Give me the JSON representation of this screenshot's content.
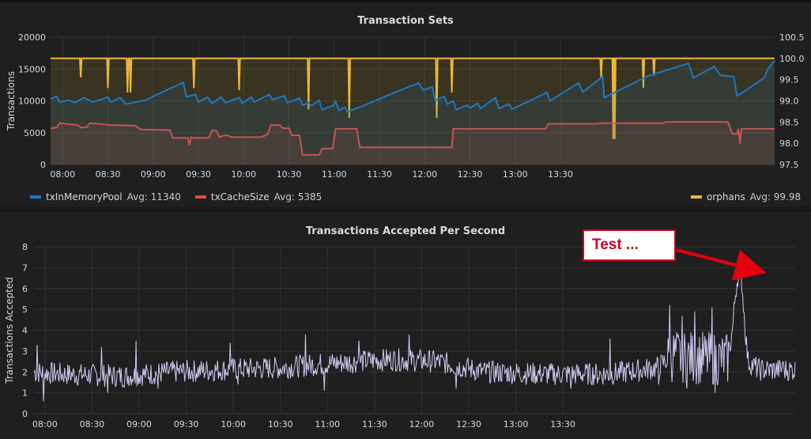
{
  "chart_data": [
    {
      "type": "line",
      "title": "Transaction Sets",
      "ylabel": "Transactions",
      "ylim": [
        0,
        20000
      ],
      "y_ticks": [
        "0",
        "5000",
        "10000",
        "15000",
        "20000"
      ],
      "y2lim": [
        97.5,
        100.5
      ],
      "y2_ticks": [
        "97.5",
        "98.0",
        "98.5",
        "99.0",
        "99.5",
        "100.0",
        "100.5"
      ],
      "x_ticks": [
        "08:00",
        "08:30",
        "09:00",
        "09:30",
        "10:00",
        "10:30",
        "11:00",
        "11:30",
        "12:00",
        "12:30",
        "13:00",
        "13:30"
      ],
      "x_range_minutes": [
        472,
        952
      ],
      "grid": true,
      "legend": "bottom",
      "series": [
        {
          "name": "txInMemoryPool",
          "avg_label": "Avg: 11340",
          "color": "#1f78c1",
          "axis": "left",
          "points": [
            [
              472,
              10300
            ],
            [
              476,
              10700
            ],
            [
              478,
              9800
            ],
            [
              484,
              10100
            ],
            [
              488,
              9700
            ],
            [
              494,
              10500
            ],
            [
              500,
              9800
            ],
            [
              510,
              10600
            ],
            [
              512,
              9800
            ],
            [
              518,
              10500
            ],
            [
              522,
              9500
            ],
            [
              535,
              10100
            ],
            [
              540,
              10700
            ],
            [
              560,
              12900
            ],
            [
              562,
              10600
            ],
            [
              568,
              11000
            ],
            [
              570,
              9800
            ],
            [
              576,
              10600
            ],
            [
              579,
              9600
            ],
            [
              585,
              10600
            ],
            [
              588,
              9700
            ],
            [
              597,
              10500
            ],
            [
              599,
              9600
            ],
            [
              605,
              10600
            ],
            [
              607,
              9800
            ],
            [
              617,
              11000
            ],
            [
              619,
              10200
            ],
            [
              627,
              10800
            ],
            [
              629,
              9700
            ],
            [
              637,
              10400
            ],
            [
              639,
              9300
            ],
            [
              643,
              9700
            ],
            [
              645,
              9200
            ],
            [
              650,
              10100
            ],
            [
              652,
              8600
            ],
            [
              656,
              9000
            ],
            [
              659,
              9200
            ],
            [
              661,
              9900
            ],
            [
              663,
              8500
            ],
            [
              667,
              9000
            ],
            [
              669,
              8300
            ],
            [
              680,
              9300
            ],
            [
              702,
              11500
            ],
            [
              716,
              12800
            ],
            [
              719,
              11700
            ],
            [
              725,
              12200
            ],
            [
              727,
              10100
            ],
            [
              733,
              10700
            ],
            [
              735,
              9500
            ],
            [
              739,
              10000
            ],
            [
              741,
              8600
            ],
            [
              748,
              9300
            ],
            [
              750,
              8900
            ],
            [
              755,
              9600
            ],
            [
              757,
              8800
            ],
            [
              767,
              10500
            ],
            [
              769,
              8800
            ],
            [
              776,
              9500
            ],
            [
              778,
              8700
            ],
            [
              801,
              11300
            ],
            [
              803,
              10000
            ],
            [
              822,
              12800
            ],
            [
              825,
              11400
            ],
            [
              838,
              13800
            ],
            [
              839,
              10500
            ],
            [
              868,
              13900
            ],
            [
              895,
              15900
            ],
            [
              898,
              13600
            ],
            [
              912,
              15400
            ],
            [
              916,
              14000
            ],
            [
              925,
              13800
            ],
            [
              927,
              10800
            ],
            [
              932,
              11500
            ],
            [
              945,
              13600
            ],
            [
              948,
              15200
            ],
            [
              952,
              16300
            ]
          ]
        },
        {
          "name": "txCacheSize",
          "avg_label": "Avg: 5385",
          "color": "#e24d42",
          "axis": "left",
          "points": [
            [
              472,
              5700
            ],
            [
              476,
              5800
            ],
            [
              478,
              6500
            ],
            [
              490,
              6200
            ],
            [
              492,
              5800
            ],
            [
              496,
              5900
            ],
            [
              498,
              6500
            ],
            [
              508,
              6300
            ],
            [
              511,
              6200
            ],
            [
              528,
              6100
            ],
            [
              532,
              5500
            ],
            [
              551,
              5400
            ],
            [
              553,
              4200
            ],
            [
              563,
              4200
            ],
            [
              564,
              3000
            ],
            [
              565,
              4300
            ],
            [
              566,
              4200
            ],
            [
              577,
              4200
            ],
            [
              579,
              5400
            ],
            [
              582,
              5300
            ],
            [
              584,
              4300
            ],
            [
              586,
              4500
            ],
            [
              588,
              4600
            ],
            [
              589,
              4600
            ],
            [
              592,
              4300
            ],
            [
              600,
              4300
            ],
            [
              612,
              4300
            ],
            [
              616,
              4800
            ],
            [
              618,
              6200
            ],
            [
              624,
              6200
            ],
            [
              626,
              5700
            ],
            [
              630,
              5700
            ],
            [
              632,
              4600
            ],
            [
              637,
              4600
            ],
            [
              639,
              1500
            ],
            [
              650,
              1500
            ],
            [
              652,
              2500
            ],
            [
              659,
              2500
            ],
            [
              661,
              5600
            ],
            [
              675,
              5600
            ],
            [
              677,
              2700
            ],
            [
              738,
              2700
            ],
            [
              739,
              5600
            ],
            [
              800,
              5600
            ],
            [
              802,
              6400
            ],
            [
              834,
              6400
            ],
            [
              836,
              6500
            ],
            [
              878,
              6500
            ],
            [
              880,
              6700
            ],
            [
              921,
              6700
            ],
            [
              923,
              5400
            ],
            [
              924,
              4800
            ],
            [
              927,
              4800
            ],
            [
              928,
              5600
            ],
            [
              929,
              3300
            ],
            [
              930,
              5600
            ],
            [
              952,
              5600
            ]
          ]
        },
        {
          "name": "orphans",
          "avg_label": "Avg: 99.98",
          "color": "#eab839",
          "axis": "right",
          "baseline": 100.0,
          "dips": [
            [
              492,
              99.55
            ],
            [
              510,
              99.3
            ],
            [
              523,
              99.2
            ],
            [
              525,
              99.2
            ],
            [
              567,
              99.3
            ],
            [
              597,
              99.25
            ],
            [
              643,
              98.8
            ],
            [
              670,
              98.6
            ],
            [
              728,
              98.6
            ],
            [
              738,
              99.2
            ],
            [
              837,
              99.55
            ],
            [
              845,
              98.1
            ],
            [
              846,
              98.1
            ],
            [
              865,
              99.3
            ],
            [
              872,
              99.6
            ]
          ]
        }
      ]
    },
    {
      "type": "line",
      "title": "Transactions Accepted Per Second",
      "ylabel": "Transactions Accepted",
      "ylim": [
        0,
        8
      ],
      "y_ticks": [
        "0",
        "1",
        "2",
        "3",
        "4",
        "5",
        "6",
        "7",
        "8"
      ],
      "x_ticks": [
        "08:00",
        "08:30",
        "09:00",
        "09:30",
        "10:00",
        "10:30",
        "11:00",
        "11:30",
        "12:00",
        "12:30",
        "13:00",
        "13:30"
      ],
      "x_range_minutes": [
        473,
        958
      ],
      "grid": true,
      "series": [
        {
          "name": "",
          "color": "#d2c8f0",
          "profile": [
            [
              473,
              2.0
            ],
            [
              490,
              1.9
            ],
            [
              530,
              1.8
            ],
            [
              560,
              2.0
            ],
            [
              590,
              2.1
            ],
            [
              630,
              2.2
            ],
            [
              660,
              2.4
            ],
            [
              700,
              2.6
            ],
            [
              730,
              2.5
            ],
            [
              760,
              2.0
            ],
            [
              800,
              1.9
            ],
            [
              840,
              1.9
            ],
            [
              870,
              2.2
            ],
            [
              880,
              2.8
            ],
            [
              890,
              2.7
            ],
            [
              915,
              2.6
            ],
            [
              918,
              4.0
            ],
            [
              920,
              5.8
            ],
            [
              922,
              6.9
            ],
            [
              924,
              6.3
            ],
            [
              926,
              4.2
            ],
            [
              928,
              2.5
            ],
            [
              935,
              2.1
            ],
            [
              958,
              2.1
            ]
          ],
          "spikes": [
            [
              475,
              3.3
            ],
            [
              516,
              3.2
            ],
            [
              538,
              3.5
            ],
            [
              598,
              3.4
            ],
            [
              646,
              3.8
            ],
            [
              680,
              3.5
            ],
            [
              712,
              3.8
            ],
            [
              840,
              3.6
            ],
            [
              878,
              5.2
            ],
            [
              886,
              4.7
            ],
            [
              894,
              4.9
            ],
            [
              905,
              5.1
            ],
            [
              950,
              2.5
            ]
          ],
          "dips": [
            [
              479,
              0.6
            ],
            [
              520,
              1.0
            ],
            [
              552,
              1.2
            ],
            [
              603,
              1.4
            ],
            [
              658,
              1.1
            ],
            [
              742,
              1.2
            ],
            [
              815,
              1.2
            ],
            [
              871,
              1.4
            ],
            [
              889,
              1.2
            ],
            [
              907,
              1.0
            ]
          ]
        }
      ]
    }
  ],
  "annotation": {
    "text": "Test ..."
  }
}
